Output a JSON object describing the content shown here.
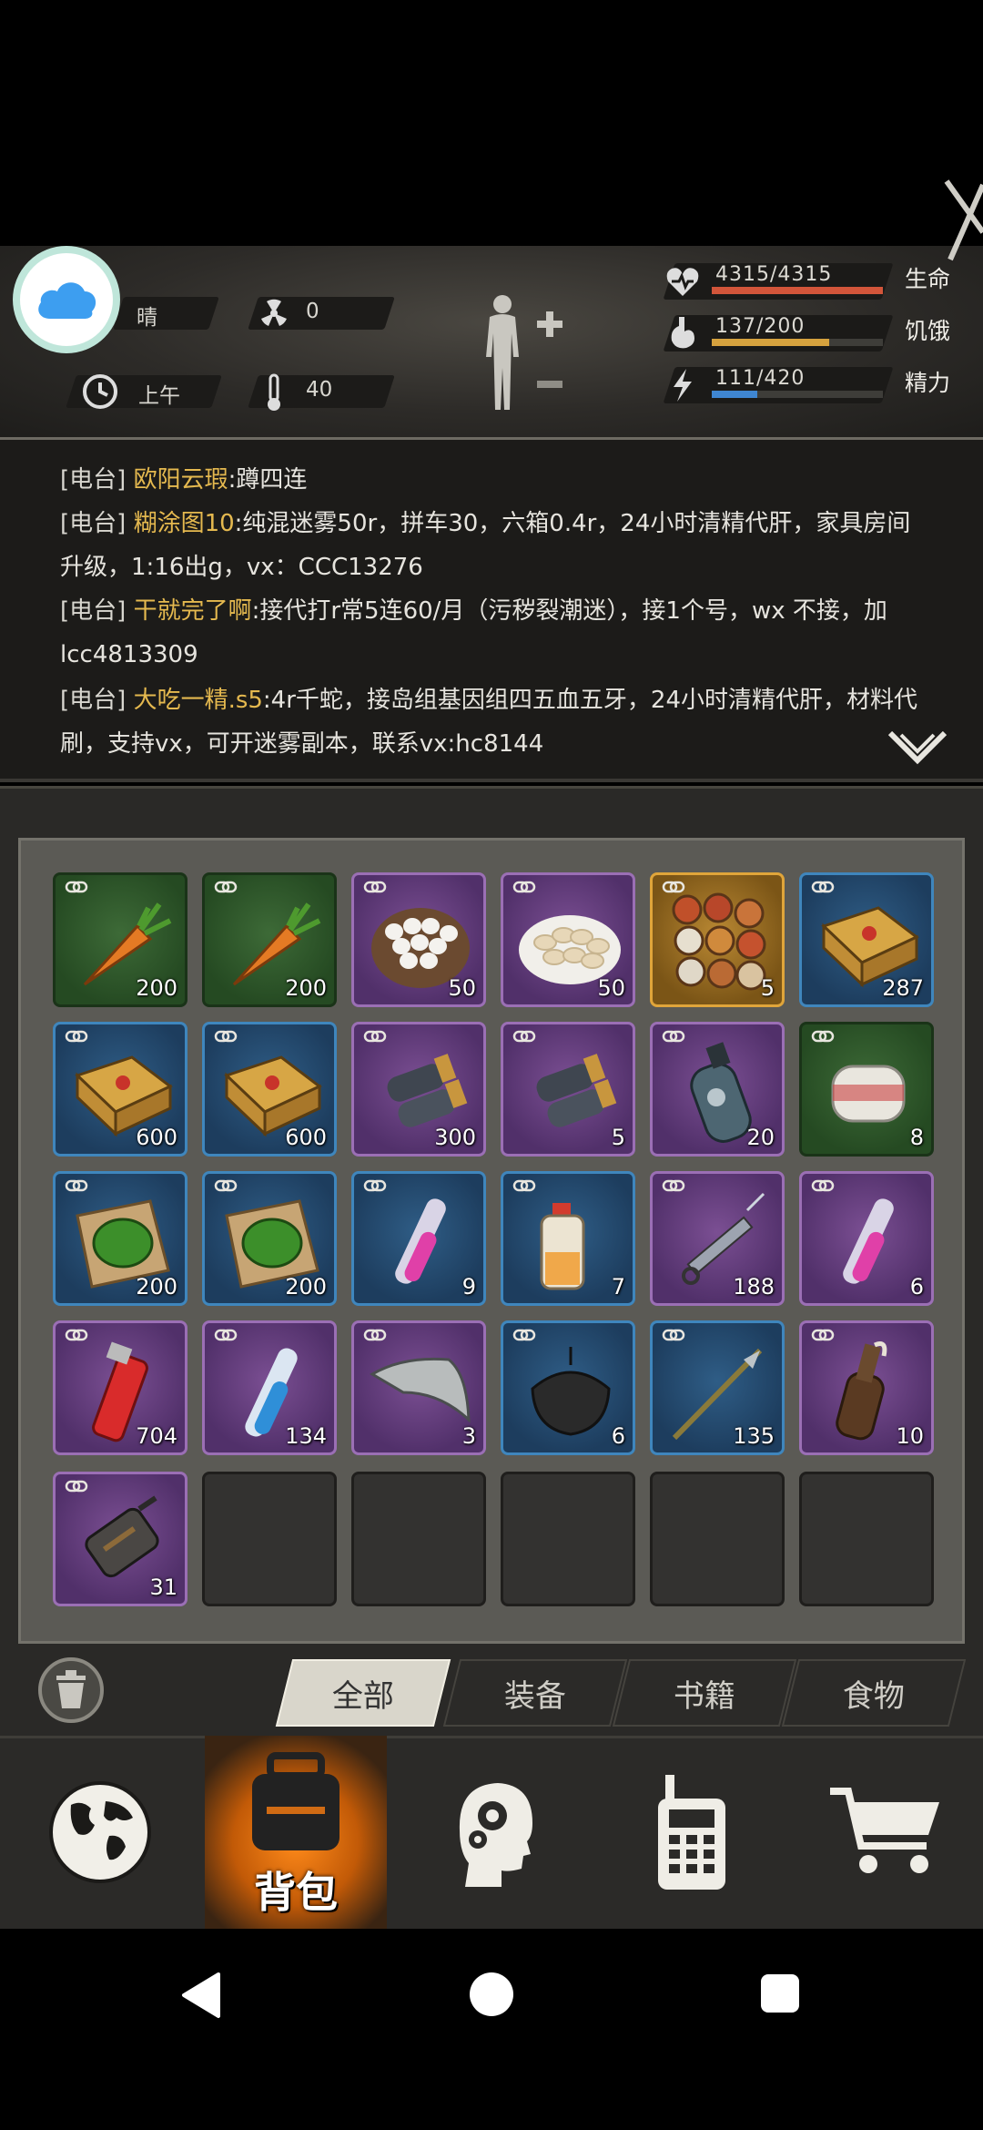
{
  "status": {
    "weather": "晴",
    "radiation": "0",
    "time_of_day": "上午",
    "temperature": "40"
  },
  "vitals": [
    {
      "name": "生命",
      "value": "4315/4315",
      "fill": 1.0,
      "color": "#d2553a",
      "icon": "heart-icon"
    },
    {
      "name": "饥饿",
      "value": "137/200",
      "fill": 0.685,
      "color": "#d6a23e",
      "icon": "stomach-icon"
    },
    {
      "name": "精力",
      "value": "111/420",
      "fill": 0.264,
      "color": "#3f86d1",
      "icon": "energy-icon"
    }
  ],
  "radio": [
    {
      "tag": "[电台]",
      "nick": "欧阳云瑕",
      "text": ":蹲四连"
    },
    {
      "tag": "[电台]",
      "nick": "糊涂图10",
      "text": ":纯混迷雾50r，拼车30，六箱0.4r，24小时清精代肝，家具房间升级，1:16出g，vx：CCC13276"
    },
    {
      "tag": "[电台]",
      "nick": "干就完了啊",
      "text": ":接代打r常5连60/月（污秽裂潮迷），接1个号，wx 不接，加lcc4813309"
    },
    {
      "tag": "[电台]",
      "nick": "大吃一精.s5",
      "text": ":4r千蛇，接岛组基因组四五血五牙，24小时清精代肝，材料代刷，支持vx，可开迷雾副本，联系vx:hc8144"
    }
  ],
  "items": [
    {
      "rarity": "green",
      "icon": "carrot-icon",
      "count": "200"
    },
    {
      "rarity": "green",
      "icon": "carrot-icon",
      "count": "200"
    },
    {
      "rarity": "purple",
      "icon": "egg-bowl-icon",
      "count": "50"
    },
    {
      "rarity": "purple",
      "icon": "dumpling-plate-icon",
      "count": "50"
    },
    {
      "rarity": "gold",
      "icon": "feast-icon",
      "count": "5"
    },
    {
      "rarity": "blue",
      "icon": "ammo-box-icon",
      "count": "287"
    },
    {
      "rarity": "blue",
      "icon": "ammo-box-icon",
      "count": "600"
    },
    {
      "rarity": "blue",
      "icon": "ammo-box-icon",
      "count": "600"
    },
    {
      "rarity": "purple",
      "icon": "shells-icon",
      "count": "300"
    },
    {
      "rarity": "purple",
      "icon": "shells-icon",
      "count": "5"
    },
    {
      "rarity": "purple",
      "icon": "gas-canister-icon",
      "count": "20"
    },
    {
      "rarity": "green",
      "icon": "bandage-roll-icon",
      "count": "8"
    },
    {
      "rarity": "blue",
      "icon": "herb-poultice-icon",
      "count": "200"
    },
    {
      "rarity": "blue",
      "icon": "herb-poultice-icon",
      "count": "200"
    },
    {
      "rarity": "blue",
      "icon": "pink-vial-icon",
      "count": "9"
    },
    {
      "rarity": "blue",
      "icon": "serum-bottle-icon",
      "count": "7"
    },
    {
      "rarity": "purple",
      "icon": "syringe-icon",
      "count": "188"
    },
    {
      "rarity": "purple",
      "icon": "pink-vial-icon",
      "count": "6"
    },
    {
      "rarity": "purple",
      "icon": "red-vial-icon",
      "count": "704"
    },
    {
      "rarity": "purple",
      "icon": "blue-vial-icon",
      "count": "134"
    },
    {
      "rarity": "purple",
      "icon": "cloth-icon",
      "count": "3"
    },
    {
      "rarity": "blue",
      "icon": "net-icon",
      "count": "6"
    },
    {
      "rarity": "blue",
      "icon": "spear-icon",
      "count": "135"
    },
    {
      "rarity": "purple",
      "icon": "molotov-icon",
      "count": "10"
    },
    {
      "rarity": "purple",
      "icon": "grenade-icon",
      "count": "31"
    },
    {
      "rarity": "empty"
    },
    {
      "rarity": "empty"
    },
    {
      "rarity": "empty"
    },
    {
      "rarity": "empty"
    },
    {
      "rarity": "empty"
    }
  ],
  "tabs": [
    {
      "label": "全部",
      "active": true
    },
    {
      "label": "装备",
      "active": false
    },
    {
      "label": "书籍",
      "active": false
    },
    {
      "label": "食物",
      "active": false
    }
  ],
  "nav": [
    {
      "name": "world-map",
      "icon": "globe-icon"
    },
    {
      "name": "backpack",
      "icon": "backpack-icon",
      "label": "背包",
      "active": true
    },
    {
      "name": "skills",
      "icon": "head-gear-icon"
    },
    {
      "name": "radio",
      "icon": "walkie-talkie-icon"
    },
    {
      "name": "shop",
      "icon": "cart-icon"
    }
  ]
}
